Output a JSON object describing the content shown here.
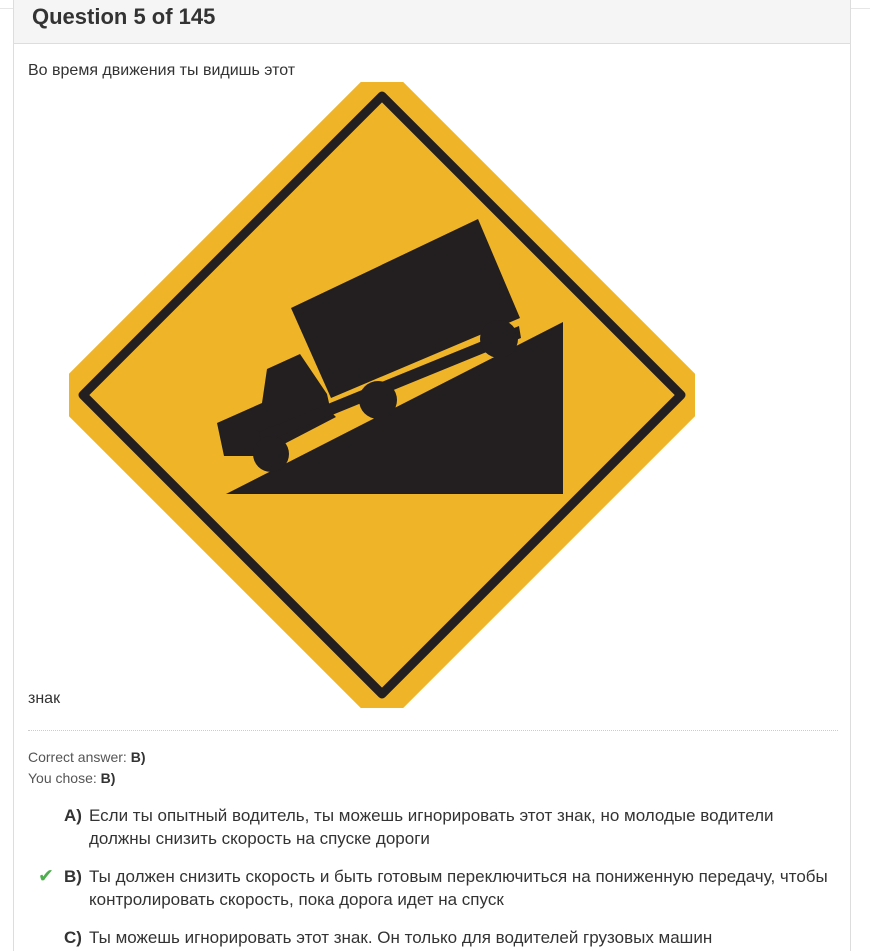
{
  "question": {
    "title": "Question 5 of 145",
    "text_before": "Во время движения ты видишь этот",
    "text_after": "знак"
  },
  "sign": {
    "depicts": "diamond-shaped yellow warning sign: truck on steep downgrade",
    "background_color": "#f0b428",
    "symbol_color": "#231f20"
  },
  "result": {
    "correct_label": "Correct answer:",
    "correct_value": "B)",
    "chose_label": "You chose:",
    "chose_value": "B)"
  },
  "answers": [
    {
      "letter": "A)",
      "text": "Если ты опытный водитель, ты можешь игнорировать этот знак, но молодые водители должны снизить скорость на спуске дороги",
      "checked": false
    },
    {
      "letter": "B)",
      "text": "Ты должен снизить скорость и быть готовым переключиться на пониженную передачу, чтобы контролировать скорость, пока дорога идет на спуск",
      "checked": true,
      "check_icon": "✔"
    },
    {
      "letter": "C)",
      "text": "Ты можешь игнорировать этот знак. Он только для водителей грузовых машин",
      "checked": false
    }
  ],
  "colors": {
    "check": "#4cae4c",
    "header_bg": "#f5f5f5"
  }
}
